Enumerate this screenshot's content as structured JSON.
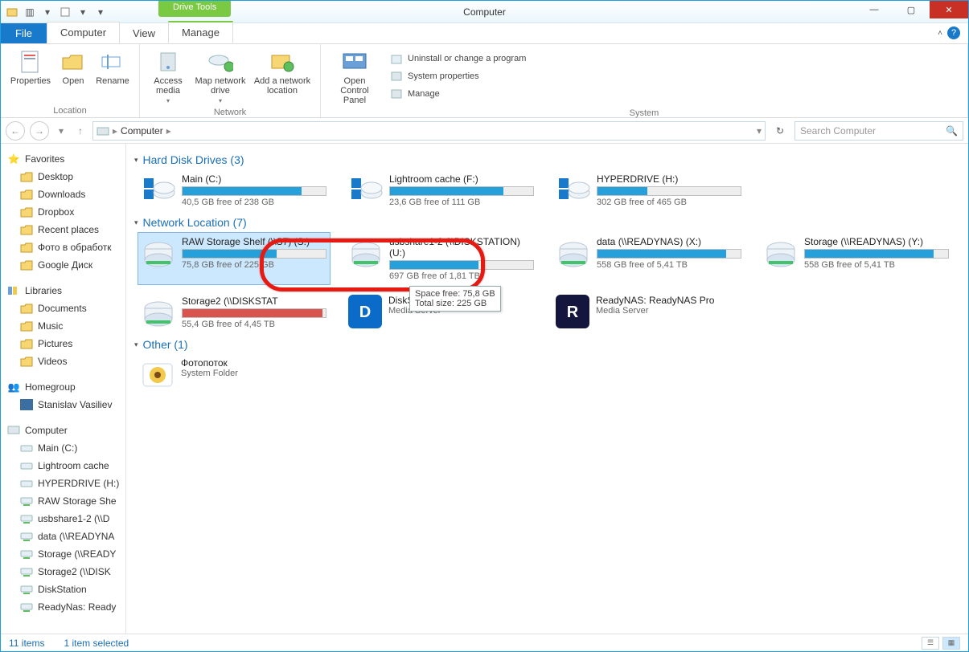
{
  "title": "Computer",
  "driveToolsBadge": "Drive Tools",
  "tabs": {
    "file": "File",
    "computer": "Computer",
    "view": "View",
    "manage": "Manage"
  },
  "ribbon": {
    "location": {
      "label": "Location",
      "properties": "Properties",
      "open": "Open",
      "rename": "Rename"
    },
    "network": {
      "label": "Network",
      "accessMedia": "Access media",
      "mapNetworkDrive": "Map network drive",
      "addNetworkLocation": "Add a network location"
    },
    "system": {
      "label": "System",
      "openControlPanel": "Open Control Panel",
      "uninstall": "Uninstall or change a program",
      "sysProps": "System properties",
      "manage": "Manage"
    }
  },
  "breadcrumb": {
    "root": "Computer"
  },
  "search": {
    "placeholder": "Search Computer"
  },
  "sidebar": {
    "favorites": {
      "label": "Favorites",
      "items": [
        "Desktop",
        "Downloads",
        "Dropbox",
        "Recent places",
        "Фото в обработк",
        "Google Диск"
      ]
    },
    "libraries": {
      "label": "Libraries",
      "items": [
        "Documents",
        "Music",
        "Pictures",
        "Videos"
      ]
    },
    "homegroup": {
      "label": "Homegroup",
      "items": [
        "Stanislav Vasiliev"
      ]
    },
    "computer": {
      "label": "Computer",
      "items": [
        "Main (C:)",
        "Lightroom cache",
        "HYPERDRIVE (H:)",
        "RAW Storage She",
        "usbshare1-2 (\\\\D",
        "data (\\\\READYNA",
        "Storage (\\\\READY",
        "Storage2 (\\\\DISK",
        "DiskStation",
        "ReadyNas: Ready"
      ]
    }
  },
  "sections": {
    "hdd": {
      "title": "Hard Disk Drives (3)"
    },
    "net": {
      "title": "Network Location (7)"
    },
    "other": {
      "title": "Other (1)"
    }
  },
  "drives": {
    "hdd": [
      {
        "name": "Main (C:)",
        "status": "40,5 GB free of 238 GB",
        "fill": 83
      },
      {
        "name": "Lightroom cache (F:)",
        "status": "23,6 GB free of 111 GB",
        "fill": 79
      },
      {
        "name": "HYPERDRIVE (H:)",
        "status": "302 GB free of 465 GB",
        "fill": 35
      }
    ],
    "net": [
      {
        "name": "RAW Storage Shelf (\\\\S7) (S:)",
        "status": "75,8 GB free of 225 GB",
        "fill": 66,
        "selected": true
      },
      {
        "name": "usbshare1-2 (\\\\DISKSTATION) (U:)",
        "status": "697 GB free of 1,81 TB",
        "fill": 62
      },
      {
        "name": "data (\\\\READYNAS) (X:)",
        "status": "558 GB free of 5,41 TB",
        "fill": 90
      },
      {
        "name": "Storage (\\\\READYNAS) (Y:)",
        "status": "558 GB free of 5,41 TB",
        "fill": 90
      },
      {
        "name": "Storage2 (\\\\DISKSTAT",
        "status": "55,4 GB free of 4,45 TB",
        "fill": 98,
        "barColor": "#d9534f"
      }
    ],
    "media": [
      {
        "name": "DiskStation",
        "sub": "Media Server",
        "iconBg": "#0a6cc8"
      },
      {
        "name": "ReadyNAS: ReadyNAS Pro",
        "sub": "Media Server",
        "iconBg": "#14163d"
      }
    ],
    "other": [
      {
        "name": "Фотопоток",
        "sub": "System Folder"
      }
    ]
  },
  "tooltip": {
    "line1": "Space free: 75,8 GB",
    "line2": "Total size: 225 GB"
  },
  "status": {
    "items": "11 items",
    "selected": "1 item selected"
  }
}
